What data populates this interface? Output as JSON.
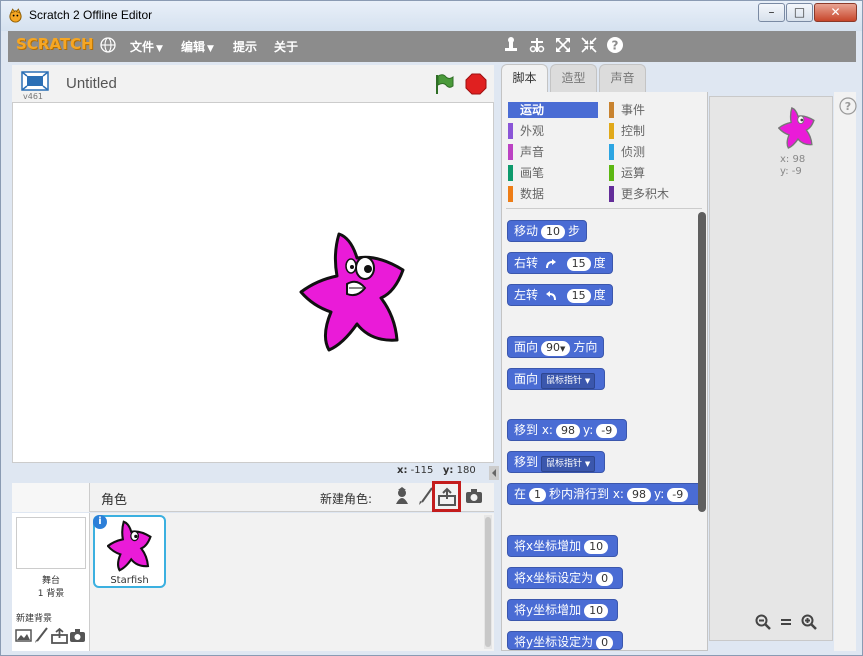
{
  "window": {
    "title": "Scratch 2 Offline Editor",
    "controls": {
      "minimize": "–",
      "maximize": "□",
      "close": "✕"
    }
  },
  "menubar": {
    "logo": "SCRATCH",
    "menus": [
      {
        "label": "文件",
        "has_arrow": true
      },
      {
        "label": "编辑",
        "has_arrow": true
      },
      {
        "label": "提示",
        "has_arrow": false
      },
      {
        "label": "关于",
        "has_arrow": false
      }
    ],
    "arrow": "▼"
  },
  "stage": {
    "version": "v461",
    "project_title": "Untitled",
    "coords": {
      "x_label": "x:",
      "x": "-115",
      "y_label": "y:",
      "y": "180"
    }
  },
  "sprites": {
    "header_label": "角色",
    "new_sprite_label": "新建角色:",
    "stage_pane": {
      "label": "舞台",
      "backdrop_count": "1 背景",
      "new_backdrop": "新建背景"
    },
    "list": [
      {
        "name": "Starfish",
        "info": "i"
      }
    ]
  },
  "tabs": [
    {
      "label": "脚本",
      "active": true
    },
    {
      "label": "造型",
      "active": false
    },
    {
      "label": "声音",
      "active": false
    }
  ],
  "categories": {
    "left": [
      {
        "label": "运动",
        "color": "#4a6cd4",
        "active": true
      },
      {
        "label": "外观",
        "color": "#8a55d7",
        "active": false
      },
      {
        "label": "声音",
        "color": "#bb42c3",
        "active": false
      },
      {
        "label": "画笔",
        "color": "#0e9a6c",
        "active": false
      },
      {
        "label": "数据",
        "color": "#ee7d16",
        "active": false
      }
    ],
    "right": [
      {
        "label": "事件",
        "color": "#c88330",
        "active": false
      },
      {
        "label": "控制",
        "color": "#e1a91a",
        "active": false
      },
      {
        "label": "侦测",
        "color": "#2ca5e2",
        "active": false
      },
      {
        "label": "运算",
        "color": "#5cb712",
        "active": false
      },
      {
        "label": "更多积木",
        "color": "#632d99",
        "active": false
      }
    ]
  },
  "blocks": {
    "move": {
      "a": "移动",
      "n": "10",
      "b": "步"
    },
    "turn_right": {
      "a": "右转",
      "n": "15",
      "b": "度"
    },
    "turn_left": {
      "a": "左转",
      "n": "15",
      "b": "度"
    },
    "point_dir": {
      "a": "面向",
      "n": "90",
      "b": "方向"
    },
    "point_toward": {
      "a": "面向",
      "dd": "鼠标指针"
    },
    "goto_xy": {
      "a": "移到 x:",
      "x": "98",
      "y_label": "y:",
      "y": "-9"
    },
    "goto": {
      "a": "移到",
      "dd": "鼠标指针"
    },
    "glide": {
      "a": "在",
      "n": "1",
      "b": "秒内滑行到 x:",
      "x": "98",
      "y_label": "y:",
      "y": "-9"
    },
    "change_x": {
      "a": "将x坐标增加",
      "n": "10"
    },
    "set_x": {
      "a": "将x坐标设定为",
      "n": "0"
    },
    "change_y": {
      "a": "将y坐标增加",
      "n": "10"
    },
    "set_y": {
      "a": "将y坐标设定为",
      "n": "0"
    }
  },
  "scripts": {
    "sprite_x_label": "x:",
    "sprite_x": "98",
    "sprite_y_label": "y:",
    "sprite_y": "-9"
  },
  "colors": {
    "motion": "#4a6cd4",
    "sprite_pink": "#ea1bd8",
    "flag_green": "#4a9a3a",
    "stop_red": "#e02020",
    "highlight_red": "#c41d1d"
  }
}
